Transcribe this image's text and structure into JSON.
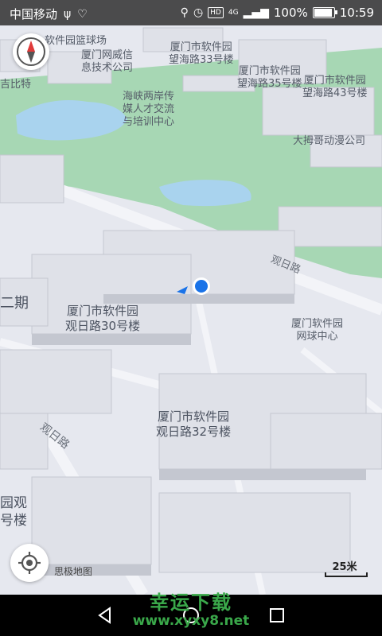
{
  "status_bar": {
    "carrier": "中国移动",
    "battery_text": "100%",
    "battery_level": 1.0,
    "time": "10:59",
    "network": "4G",
    "hd": "HD"
  },
  "map": {
    "pois": [
      {
        "label": "厦门市软件园\n望海路33号楼"
      },
      {
        "label": "厦门网威信\n息技术公司"
      },
      {
        "label": "软件园篮球场"
      },
      {
        "label": "吉比特"
      },
      {
        "label": "海峡两岸传\n媒人才交流\n与培训中心"
      },
      {
        "label": "厦门市软件园\n望海路35号楼"
      },
      {
        "label": "厦门市软件园\n望海路43号楼"
      },
      {
        "label": "大拇哥动漫公司"
      },
      {
        "label": "厦门市软件园\n观日路30号楼"
      },
      {
        "label": "厦门软件园\n网球中心"
      },
      {
        "label": "厦门市软件园\n观日路32号楼"
      },
      {
        "label": "二期"
      },
      {
        "label": "园观\n号楼"
      }
    ],
    "roads": [
      "观日路",
      "观日路"
    ],
    "brand": "思极地图",
    "scale_label": "25米"
  },
  "watermark": {
    "cn": "幸运下载",
    "url": "www.xyxy8.net"
  },
  "colors": {
    "park": "#a7d7b4",
    "water": "#a9d3ee",
    "building_top": "#dfe1e8",
    "building_side": "#c4c7d0",
    "location_dot": "#1a73e8",
    "watermark": "#3aa84a"
  },
  "icons": [
    "compass-icon",
    "locate-icon",
    "back-icon",
    "home-icon",
    "recents-icon"
  ]
}
